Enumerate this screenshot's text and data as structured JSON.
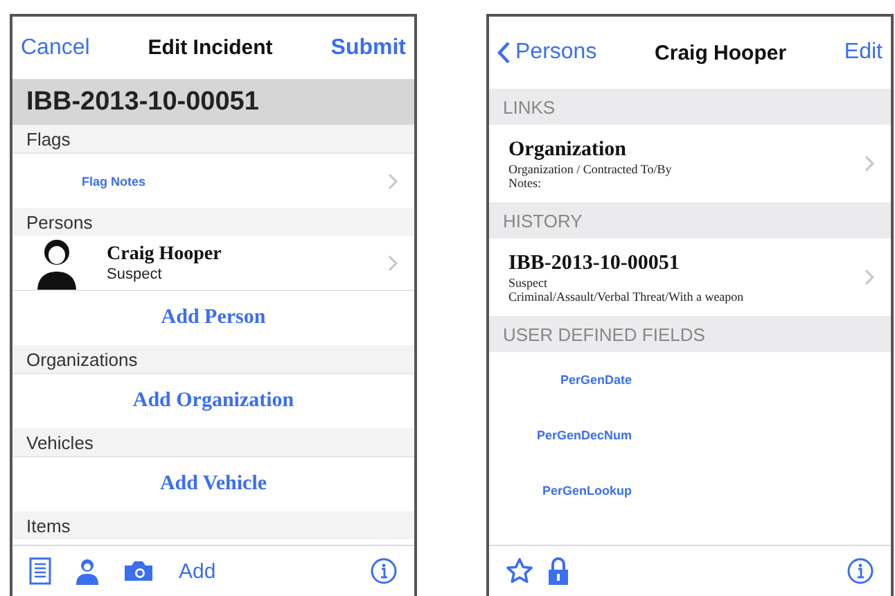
{
  "edit_screen": {
    "nav": {
      "left": "Cancel",
      "title": "Edit Incident",
      "right": "Submit"
    },
    "incident_id": "IBB-2013-10-00051",
    "sections": [
      {
        "header": "Flags",
        "rows": [
          {
            "kind": "link",
            "label": "Flag Notes"
          }
        ]
      },
      {
        "header": "Persons",
        "rows": [
          {
            "kind": "person",
            "name": "Craig Hooper",
            "role": "Suspect"
          },
          {
            "kind": "add",
            "label": "Add Person"
          }
        ]
      },
      {
        "header": "Organizations",
        "rows": [
          {
            "kind": "add",
            "label": "Add Organization"
          }
        ]
      },
      {
        "header": "Vehicles",
        "rows": [
          {
            "kind": "add",
            "label": "Add Vehicle"
          }
        ]
      },
      {
        "header": "Items"
      }
    ],
    "toolbar": {
      "add_label": "Add"
    }
  },
  "person_screen": {
    "nav": {
      "back": "Persons",
      "title": "Craig Hooper",
      "right": "Edit"
    },
    "sections": [
      {
        "header": "LINKS",
        "rows": [
          {
            "kind": "detail",
            "title": "Organization",
            "lines": [
              "Organization / Contracted To/By",
              "Notes:"
            ]
          }
        ]
      },
      {
        "header": "HISTORY",
        "rows": [
          {
            "kind": "detail",
            "title": "IBB-2013-10-00051",
            "lines": [
              "Suspect",
              "Criminal/Assault/Verbal Threat/With a weapon"
            ]
          }
        ]
      },
      {
        "header": "USER DEFINED FIELDS",
        "rows": [
          {
            "kind": "field",
            "label": "PerGenDate"
          },
          {
            "kind": "field",
            "label": "PerGenDecNum"
          },
          {
            "kind": "field",
            "label": "PerGenLookup"
          }
        ]
      }
    ]
  }
}
